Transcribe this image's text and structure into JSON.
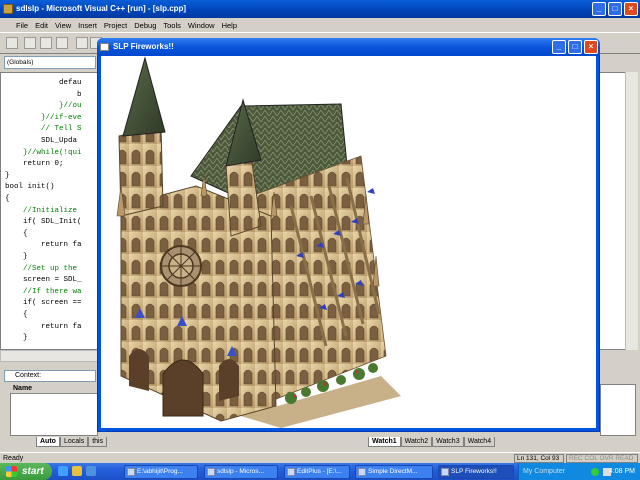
{
  "ide": {
    "title": "sdlslp - Microsoft Visual C++ [run] - [slp.cpp]",
    "menu": [
      "File",
      "Edit",
      "View",
      "Insert",
      "Project",
      "Debug",
      "Tools",
      "Window",
      "Help"
    ],
    "scope_combo": "(Globals)"
  },
  "code_lines": [
    {
      "text": "            defau",
      "cls": ""
    },
    {
      "text": "                b",
      "cls": ""
    },
    {
      "text": "            }//ou",
      "cls": "cm"
    },
    {
      "text": "        }//if-eve",
      "cls": "cm"
    },
    {
      "text": "        // Tell S",
      "cls": "cm"
    },
    {
      "text": "        SDL_Upda",
      "cls": ""
    },
    {
      "text": "    }//while(!qui",
      "cls": "cm"
    },
    {
      "text": "    return 0;",
      "cls": ""
    },
    {
      "text": "}",
      "cls": ""
    },
    {
      "text": "bool init()",
      "cls": ""
    },
    {
      "text": "{",
      "cls": ""
    },
    {
      "text": "    //Initialize",
      "cls": "cm"
    },
    {
      "text": "    if( SDL_Init(",
      "cls": ""
    },
    {
      "text": "    {",
      "cls": ""
    },
    {
      "text": "        return fa",
      "cls": ""
    },
    {
      "text": "    }",
      "cls": ""
    },
    {
      "text": "    //Set up the",
      "cls": "cm"
    },
    {
      "text": "    screen = SDL_",
      "cls": ""
    },
    {
      "text": "    //If there wa",
      "cls": "cm"
    },
    {
      "text": "    if( screen ==",
      "cls": ""
    },
    {
      "text": "    {",
      "cls": ""
    },
    {
      "text": "        return fa",
      "cls": ""
    },
    {
      "text": "    }",
      "cls": ""
    }
  ],
  "debug": {
    "context_label": "Context:",
    "name_header": "Name",
    "var_tabs": [
      "Auto",
      "Locals",
      "this"
    ],
    "watch_tabs": [
      "Watch1",
      "Watch2",
      "Watch3",
      "Watch4"
    ]
  },
  "status": {
    "text": "Ready",
    "position": "Ln 131, Col 93",
    "indicators": "REC COL OVR READ"
  },
  "taskbar": {
    "start": "start",
    "tasks": [
      "E:\\abhijit\\Prog...",
      "sdlslp - Micros...",
      "EditPlus - [E:\\...",
      "Simple DirectM...",
      "SLP Fireworks!!"
    ],
    "tray_label": "My Computer",
    "clock": "4:08 PM"
  },
  "fireworks": {
    "title": "SLP Fireworks!!"
  }
}
